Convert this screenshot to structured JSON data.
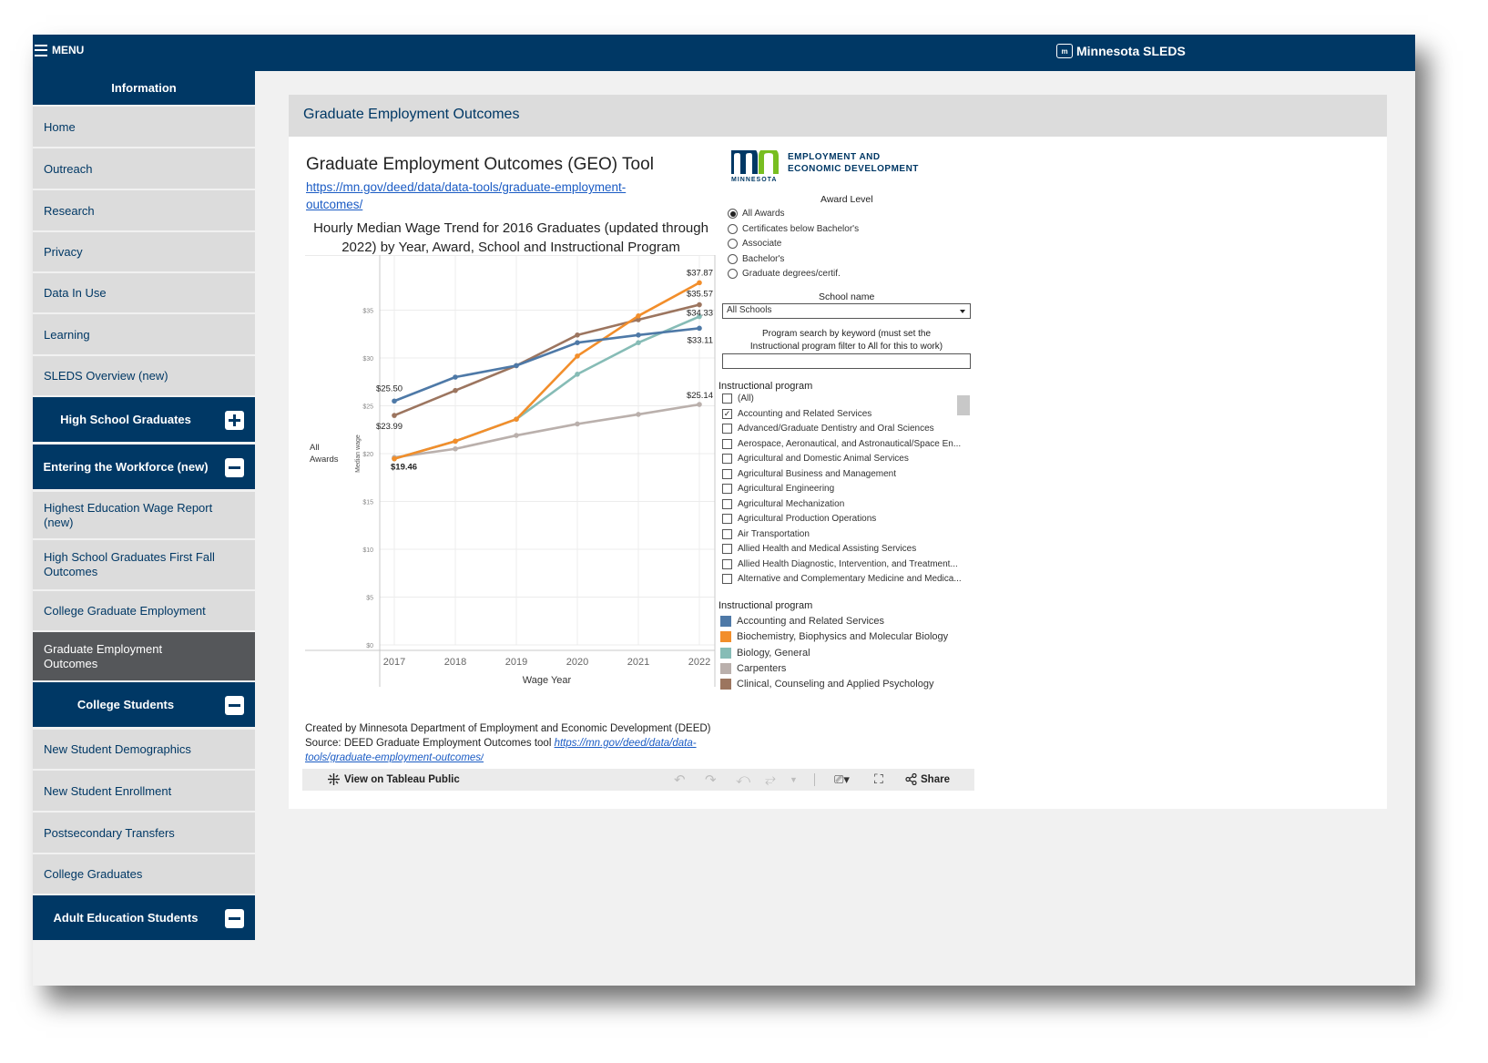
{
  "topbar": {
    "menu_label": "MENU",
    "brand": "Minnesota SLEDS",
    "brand_logo": "m"
  },
  "sidebar": {
    "info_header": "Information",
    "items": [
      "Home",
      "Outreach",
      "Research",
      "Privacy",
      "Data In Use",
      "Learning",
      "SLEDS Overview (new)"
    ],
    "sections": {
      "hs": "High School Graduates",
      "workforce": "Entering the Workforce (new)",
      "college": "College Students",
      "adult": "Adult Education Students"
    },
    "workforce_items": [
      "Highest Education Wage Report (new)",
      "High School Graduates First Fall Outcomes",
      "College Graduate Employment",
      "Graduate Employment Outcomes"
    ],
    "college_items": [
      "New Student Demographics",
      "New Student Enrollment",
      "Postsecondary Transfers",
      "College Graduates"
    ]
  },
  "main": {
    "header": "Graduate Employment Outcomes",
    "tool_title": "Graduate Employment Outcomes (GEO) Tool",
    "tool_link": "https://mn.gov/deed/data/data-tools/graduate-employment-outcomes/",
    "chart_title": "Hourly Median Wage Trend for 2016 Graduates (updated through 2022) by Year, Award, School and Instructional Program",
    "credit_line1": "Created by Minnesota Department of Employment and Economic Development (DEED)",
    "credit_line2_prefix": "Source: DEED Graduate Employment Outcomes tool ",
    "credit_link_a": "https://mn.gov/deed/data/data-",
    "credit_link_b": "tools/graduate-employment-outcomes/",
    "toolbar": {
      "view_label": "View on Tableau Public",
      "share_label": "Share"
    }
  },
  "logo": {
    "line1": "EMPLOYMENT AND",
    "line2": "ECONOMIC DEVELOPMENT",
    "state": "MINNESOTA"
  },
  "filters": {
    "award_label": "Award Level",
    "award_options": [
      "All Awards",
      "Certificates below Bachelor's",
      "Associate",
      "Bachelor's",
      "Graduate degrees/certif."
    ],
    "school_label": "School name",
    "school_value": "All Schools",
    "keyword_label_1": "Program search by keyword (must set the",
    "keyword_label_2": "Instructional program filter to All for this to work)",
    "program_label": "Instructional program",
    "program_options": [
      "(All)",
      "Accounting and Related Services",
      "Advanced/Graduate Dentistry and Oral Sciences",
      "Aerospace, Aeronautical, and Astronautical/Space En...",
      "Agricultural and Domestic Animal Services",
      "Agricultural Business and Management",
      "Agricultural Engineering",
      "Agricultural Mechanization",
      "Agricultural Production Operations",
      "Air Transportation",
      "Allied Health and Medical Assisting Services",
      "Allied Health Diagnostic, Intervention, and Treatment...",
      "Alternative and Complementary Medicine and Medica..."
    ],
    "program_checked": [
      "Accounting and Related Services"
    ],
    "legend_label": "Instructional program"
  },
  "chart_data": {
    "type": "line",
    "x": [
      "2017",
      "2018",
      "2019",
      "2020",
      "2021",
      "2022"
    ],
    "xlabel": "Wage Year",
    "ylabel": "Median wage",
    "row_label_1": "All",
    "row_label_2": "Awards",
    "ylim": [
      0,
      40
    ],
    "yticks": [
      0,
      5,
      10,
      15,
      20,
      25,
      30,
      35
    ],
    "ytick_labels": [
      "$0",
      "$5",
      "$10",
      "$15",
      "$20",
      "$25",
      "$30",
      "$35"
    ],
    "grid": true,
    "legend": "right",
    "series": [
      {
        "name": "Accounting and Related Services",
        "color": "#4e79a7",
        "values": [
          25.5,
          28.0,
          29.2,
          31.6,
          32.4,
          33.11
        ],
        "label_first": "$25.50",
        "label_last": "$33.11"
      },
      {
        "name": "Biochemistry, Biophysics and Molecular Biology",
        "color": "#f28e2b",
        "values": [
          19.46,
          21.3,
          23.6,
          30.2,
          34.4,
          37.87
        ],
        "label_first": "$19.46",
        "label_last": "$37.87"
      },
      {
        "name": "Biology, General",
        "color": "#86bcb6",
        "values": [
          19.46,
          21.3,
          23.6,
          28.3,
          31.6,
          34.33
        ],
        "label_first": "",
        "label_last": "$34.33"
      },
      {
        "name": "Carpenters",
        "color": "#bab0ac",
        "values": [
          19.6,
          20.5,
          21.9,
          23.1,
          24.1,
          25.14
        ],
        "label_first": "",
        "label_last": "$25.14"
      },
      {
        "name": "Clinical, Counseling and Applied Psychology",
        "color": "#9c755f",
        "values": [
          23.99,
          26.6,
          29.2,
          32.4,
          34.0,
          35.57
        ],
        "label_first": "$23.99",
        "label_last": "$35.57"
      }
    ]
  }
}
